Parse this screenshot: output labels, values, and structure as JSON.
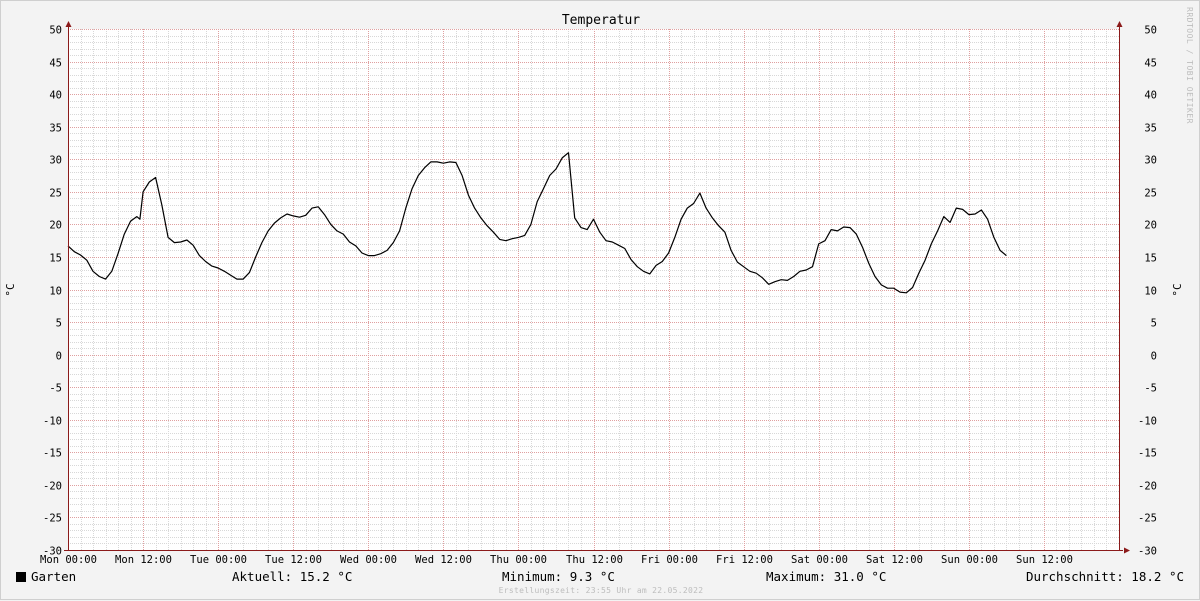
{
  "chart_data": {
    "type": "line",
    "title": "Temperatur",
    "ylabel": "°C",
    "ylabel_right": "°C",
    "ylim": [
      -30,
      50
    ],
    "yticks": [
      50,
      45,
      40,
      35,
      30,
      25,
      20,
      15,
      10,
      5,
      0,
      -5,
      -10,
      -15,
      -20,
      -25,
      -30
    ],
    "xlim": [
      0,
      168
    ],
    "x_unit": "hours since Mon 00:00",
    "xticks": [
      {
        "x": 0,
        "label": "Mon 00:00"
      },
      {
        "x": 12,
        "label": "Mon 12:00"
      },
      {
        "x": 24,
        "label": "Tue 00:00"
      },
      {
        "x": 36,
        "label": "Tue 12:00"
      },
      {
        "x": 48,
        "label": "Wed 00:00"
      },
      {
        "x": 60,
        "label": "Wed 12:00"
      },
      {
        "x": 72,
        "label": "Thu 00:00"
      },
      {
        "x": 84,
        "label": "Thu 12:00"
      },
      {
        "x": 96,
        "label": "Fri 00:00"
      },
      {
        "x": 108,
        "label": "Fri 12:00"
      },
      {
        "x": 120,
        "label": "Sat 00:00"
      },
      {
        "x": 132,
        "label": "Sat 12:00"
      },
      {
        "x": 144,
        "label": "Sun 00:00"
      },
      {
        "x": 156,
        "label": "Sun 12:00"
      }
    ],
    "grid": true,
    "series": [
      {
        "name": "Garten",
        "color": "#000000",
        "points": [
          [
            0,
            16.7
          ],
          [
            1,
            15.8
          ],
          [
            2,
            15.3
          ],
          [
            3,
            14.5
          ],
          [
            4,
            12.8
          ],
          [
            5,
            12.0
          ],
          [
            6,
            11.6
          ],
          [
            7,
            12.8
          ],
          [
            8,
            15.5
          ],
          [
            9,
            18.5
          ],
          [
            10,
            20.5
          ],
          [
            11,
            21.2
          ],
          [
            11.5,
            20.8
          ],
          [
            12,
            25.0
          ],
          [
            13,
            26.5
          ],
          [
            14,
            27.2
          ],
          [
            15,
            23.0
          ],
          [
            16,
            18.0
          ],
          [
            17,
            17.2
          ],
          [
            18,
            17.3
          ],
          [
            19,
            17.6
          ],
          [
            20,
            16.8
          ],
          [
            21,
            15.2
          ],
          [
            22,
            14.3
          ],
          [
            23,
            13.6
          ],
          [
            24,
            13.3
          ],
          [
            25,
            12.8
          ],
          [
            26,
            12.2
          ],
          [
            27,
            11.6
          ],
          [
            28,
            11.6
          ],
          [
            29,
            12.6
          ],
          [
            30,
            15.0
          ],
          [
            31,
            17.2
          ],
          [
            32,
            19.0
          ],
          [
            33,
            20.2
          ],
          [
            34,
            21.0
          ],
          [
            35,
            21.6
          ],
          [
            36,
            21.3
          ],
          [
            37,
            21.1
          ],
          [
            38,
            21.4
          ],
          [
            39,
            22.5
          ],
          [
            40,
            22.7
          ],
          [
            41,
            21.5
          ],
          [
            42,
            20.0
          ],
          [
            43,
            19.0
          ],
          [
            44,
            18.5
          ],
          [
            45,
            17.3
          ],
          [
            46,
            16.7
          ],
          [
            47,
            15.6
          ],
          [
            48,
            15.2
          ],
          [
            49,
            15.2
          ],
          [
            50,
            15.5
          ],
          [
            51,
            16.0
          ],
          [
            52,
            17.2
          ],
          [
            53,
            19.0
          ],
          [
            54,
            22.5
          ],
          [
            55,
            25.5
          ],
          [
            56,
            27.5
          ],
          [
            57,
            28.7
          ],
          [
            58,
            29.6
          ],
          [
            59,
            29.6
          ],
          [
            60,
            29.4
          ],
          [
            61,
            29.6
          ],
          [
            62,
            29.5
          ],
          [
            63,
            27.5
          ],
          [
            64,
            24.5
          ],
          [
            65,
            22.5
          ],
          [
            66,
            21.0
          ],
          [
            67,
            19.8
          ],
          [
            68,
            18.8
          ],
          [
            69,
            17.7
          ],
          [
            70,
            17.5
          ],
          [
            71,
            17.8
          ],
          [
            72,
            18.0
          ],
          [
            73,
            18.3
          ],
          [
            74,
            20.0
          ],
          [
            75,
            23.5
          ],
          [
            76,
            25.5
          ],
          [
            77,
            27.5
          ],
          [
            78,
            28.5
          ],
          [
            79,
            30.2
          ],
          [
            80,
            31.0
          ],
          [
            81,
            21.0
          ],
          [
            82,
            19.5
          ],
          [
            83,
            19.2
          ],
          [
            84,
            20.8
          ],
          [
            85,
            18.8
          ],
          [
            86,
            17.5
          ],
          [
            87,
            17.3
          ],
          [
            88,
            16.8
          ],
          [
            89,
            16.3
          ],
          [
            90,
            14.6
          ],
          [
            91,
            13.5
          ],
          [
            92,
            12.8
          ],
          [
            93,
            12.4
          ],
          [
            94,
            13.7
          ],
          [
            95,
            14.3
          ],
          [
            96,
            15.6
          ],
          [
            97,
            18.0
          ],
          [
            98,
            20.8
          ],
          [
            99,
            22.5
          ],
          [
            100,
            23.2
          ],
          [
            101,
            24.8
          ],
          [
            102,
            22.5
          ],
          [
            103,
            21.0
          ],
          [
            104,
            19.8
          ],
          [
            105,
            18.8
          ],
          [
            106,
            16.0
          ],
          [
            107,
            14.2
          ],
          [
            108,
            13.5
          ],
          [
            109,
            12.8
          ],
          [
            110,
            12.5
          ],
          [
            111,
            11.8
          ],
          [
            112,
            10.8
          ],
          [
            113,
            11.2
          ],
          [
            114,
            11.5
          ],
          [
            115,
            11.4
          ],
          [
            116,
            12.0
          ],
          [
            117,
            12.8
          ],
          [
            118,
            13.0
          ],
          [
            119,
            13.5
          ],
          [
            120,
            17.0
          ],
          [
            121,
            17.5
          ],
          [
            122,
            19.2
          ],
          [
            123,
            19.0
          ],
          [
            124,
            19.6
          ],
          [
            125,
            19.5
          ],
          [
            126,
            18.5
          ],
          [
            127,
            16.5
          ],
          [
            128,
            14.0
          ],
          [
            129,
            12.0
          ],
          [
            130,
            10.7
          ],
          [
            131,
            10.2
          ],
          [
            132,
            10.2
          ],
          [
            133,
            9.6
          ],
          [
            134,
            9.5
          ],
          [
            135,
            10.3
          ],
          [
            136,
            12.5
          ],
          [
            137,
            14.5
          ],
          [
            138,
            17.0
          ],
          [
            139,
            19.0
          ],
          [
            140,
            21.2
          ],
          [
            141,
            20.3
          ],
          [
            142,
            22.5
          ],
          [
            143,
            22.3
          ],
          [
            144,
            21.5
          ],
          [
            145,
            21.6
          ],
          [
            146,
            22.2
          ],
          [
            147,
            20.8
          ],
          [
            148,
            18.0
          ],
          [
            149,
            16.0
          ],
          [
            150,
            15.2
          ]
        ]
      }
    ]
  },
  "legend": {
    "series_name": "Garten",
    "stats": {
      "current": "Aktuell: 15.2 °C",
      "minimum": "Minimum: 9.3 °C",
      "maximum": "Maximum: 31.0 °C",
      "average": "Durchschnitt: 18.2 °C"
    }
  },
  "footer": "Erstellungszeit: 23:55 Uhr am 22.05.2022",
  "watermark": "RRDTOOL / TOBI OETIKER",
  "colors": {
    "background": "#f3f3f3",
    "plot": "#ffffff",
    "major_grid": "#e0a0a0",
    "minor_grid": "#d8d8d8",
    "axis": "#8b1a1a",
    "line": "#000000"
  }
}
